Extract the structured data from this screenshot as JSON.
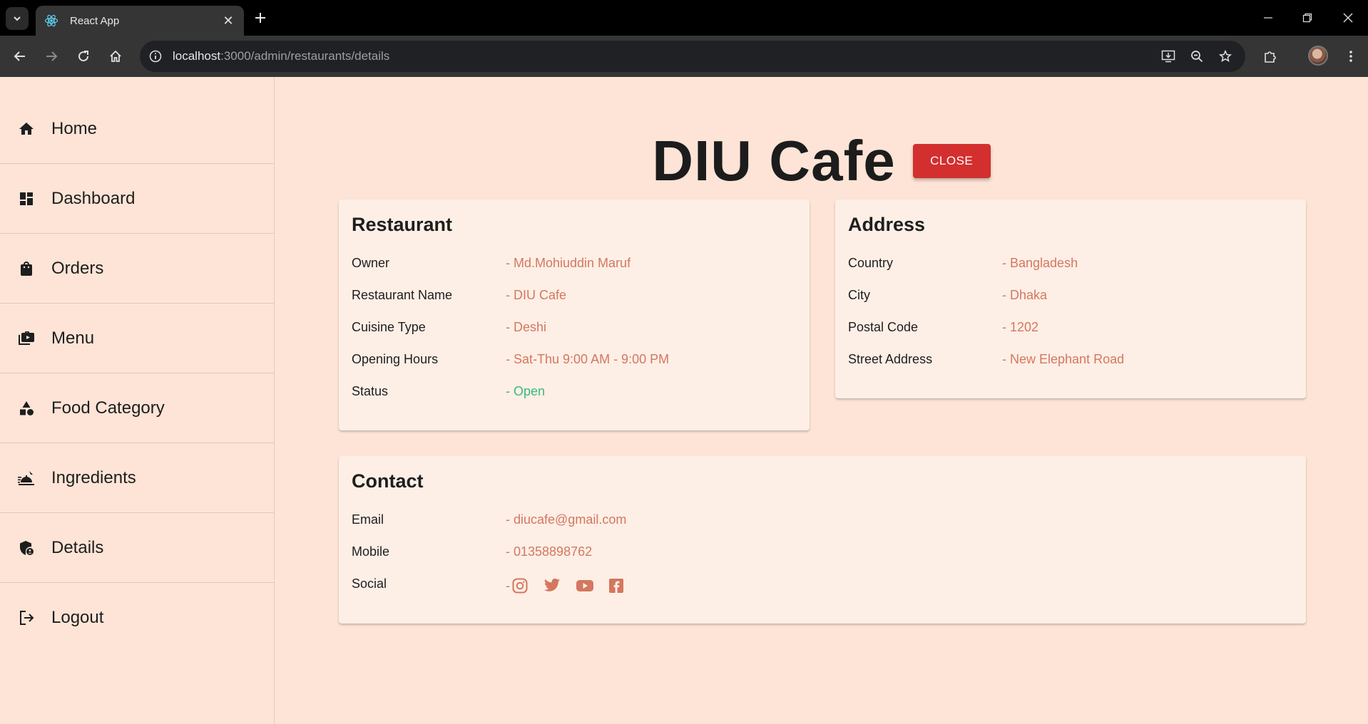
{
  "browser": {
    "tab_title": "React App",
    "url_host": "localhost",
    "url_rest": ":3000/admin/restaurants/details"
  },
  "sidebar": {
    "items": [
      {
        "label": "Home",
        "icon": "home-icon"
      },
      {
        "label": "Dashboard",
        "icon": "dashboard-icon"
      },
      {
        "label": "Orders",
        "icon": "shopping-bag-icon"
      },
      {
        "label": "Menu",
        "icon": "menu-book-icon"
      },
      {
        "label": "Food Category",
        "icon": "category-icon"
      },
      {
        "label": "Ingredients",
        "icon": "ingredients-icon"
      },
      {
        "label": "Details",
        "icon": "admin-details-icon"
      },
      {
        "label": "Logout",
        "icon": "logout-icon"
      }
    ]
  },
  "header": {
    "title": "DIU Cafe",
    "close_label": "CLOSE"
  },
  "restaurant": {
    "title": "Restaurant",
    "rows": [
      {
        "label": "Owner",
        "value": "- Md.Mohiuddin Maruf"
      },
      {
        "label": "Restaurant Name",
        "value": "- DIU Cafe"
      },
      {
        "label": "Cuisine Type",
        "value": "- Deshi"
      },
      {
        "label": "Opening Hours",
        "value": "- Sat-Thu 9:00 AM - 9:00 PM"
      },
      {
        "label": "Status",
        "value": "- Open"
      }
    ]
  },
  "address": {
    "title": "Address",
    "rows": [
      {
        "label": "Country",
        "value": "- Bangladesh"
      },
      {
        "label": "City",
        "value": "- Dhaka"
      },
      {
        "label": "Postal Code",
        "value": "- 1202"
      },
      {
        "label": "Street Address",
        "value": "- New Elephant Road"
      }
    ]
  },
  "contact": {
    "title": "Contact",
    "rows": [
      {
        "label": "Email",
        "value": "- diucafe@gmail.com"
      },
      {
        "label": "Mobile",
        "value": "- 01358898762"
      }
    ],
    "social_label": "Social",
    "social_dash": "-",
    "social_icons": [
      "instagram-icon",
      "twitter-icon",
      "youtube-icon",
      "facebook-icon"
    ]
  },
  "colors": {
    "background": "#fde4d6",
    "card": "#fdefe6",
    "value": "#d4775f",
    "status_open": "#3cb87a",
    "close_button": "#d32f2f"
  }
}
